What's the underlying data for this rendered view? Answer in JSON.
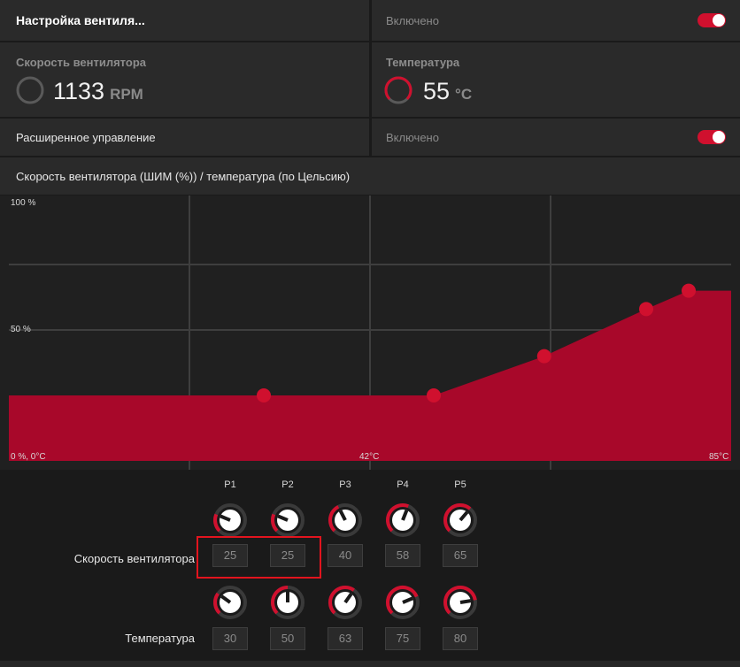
{
  "header": {
    "title": "Настройка вентиля...",
    "status": "Включено"
  },
  "fan_speed": {
    "label": "Скорость вентилятора",
    "value": "1133",
    "unit": "RPM"
  },
  "temperature": {
    "label": "Температура",
    "value": "55",
    "unit": "°C"
  },
  "advanced": {
    "label": "Расширенное управление",
    "status": "Включено"
  },
  "chart_title": "Скорость вентилятора (ШИМ (%)) / температура (по Цельсию)",
  "colors": {
    "accent": "#d0102e",
    "fill": "#a8082a",
    "bg": "#2a2a2a"
  },
  "chart_data": {
    "type": "area",
    "y_tick_labels": [
      "100 %",
      "50 %",
      "0 %, 0°C"
    ],
    "x_tick_labels": [
      "42°C",
      "85°C"
    ],
    "xlim": [
      0,
      85
    ],
    "ylim": [
      0,
      100
    ],
    "points": [
      {
        "x": 30,
        "y": 25
      },
      {
        "x": 50,
        "y": 25
      },
      {
        "x": 63,
        "y": 40
      },
      {
        "x": 75,
        "y": 58
      },
      {
        "x": 80,
        "y": 65
      }
    ],
    "grid": true
  },
  "points": {
    "labels": [
      "P1",
      "P2",
      "P3",
      "P4",
      "P5"
    ],
    "speed_label": "Скорость вентилятора",
    "temp_label": "Температура",
    "speed_values": [
      "25",
      "25",
      "40",
      "58",
      "65"
    ],
    "temp_values": [
      "30",
      "50",
      "63",
      "75",
      "80"
    ],
    "speed_levels": [
      25,
      25,
      40,
      58,
      65
    ],
    "temp_levels": [
      30,
      50,
      63,
      75,
      80
    ]
  }
}
